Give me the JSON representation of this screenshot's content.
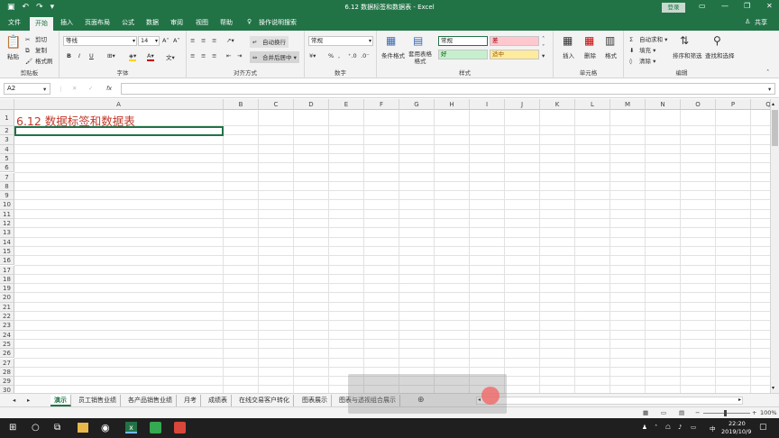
{
  "window": {
    "title": "6.12 数据标签和数据表 - Excel",
    "login": "登录",
    "share": "共享"
  },
  "tabs": [
    "文件",
    "开始",
    "插入",
    "页面布局",
    "公式",
    "数据",
    "审阅",
    "视图",
    "帮助"
  ],
  "tell_me": "操作说明搜索",
  "ribbon": {
    "clipboard": {
      "label": "剪贴板",
      "paste": "粘贴",
      "cut": "剪切",
      "copy": "复制",
      "format_painter": "格式刷"
    },
    "font": {
      "label": "字体",
      "name": "等线",
      "size": "14",
      "bold": "B",
      "italic": "I",
      "underline": "U"
    },
    "alignment": {
      "label": "对齐方式",
      "wrap": "自动换行",
      "merge": "合并后居中"
    },
    "number": {
      "label": "数字",
      "format": "常规",
      "percent": "%"
    },
    "styles": {
      "label": "样式",
      "cond_format": "条件格式",
      "table_format": "套用表格格式",
      "normal": "常规",
      "bad": "差",
      "good": "好",
      "neutral": "适中"
    },
    "cells": {
      "label": "单元格",
      "insert": "插入",
      "delete": "删除",
      "format": "格式"
    },
    "editing": {
      "label": "编辑",
      "autosum": "自动求和",
      "fill": "填充",
      "clear": "清除",
      "sort_filter": "排序和筛选",
      "find_select": "查找和选择"
    }
  },
  "formula_bar": {
    "name_box": "A2",
    "fx": "fx",
    "value": ""
  },
  "columns": [
    "A",
    "B",
    "C",
    "D",
    "E",
    "F",
    "G",
    "H",
    "I",
    "J",
    "K",
    "L",
    "M",
    "N",
    "O",
    "P",
    "Q"
  ],
  "rows": [
    "1",
    "2",
    "3",
    "4",
    "5",
    "6",
    "7",
    "8",
    "9",
    "10",
    "11",
    "12",
    "13",
    "14",
    "15",
    "16",
    "17",
    "18",
    "19",
    "20",
    "21",
    "22",
    "23",
    "24",
    "25",
    "26",
    "27",
    "28",
    "29",
    "30"
  ],
  "cells": {
    "A1": "6.12 数据标签和数据表"
  },
  "sheets": [
    "演示",
    "员工销售业绩",
    "各产品销售业绩",
    "月考",
    "成绩表",
    "在线交易客户转化",
    "图表展示",
    "图表与透视组合展示"
  ],
  "active_sheet": "演示",
  "status": {
    "zoom": "100%"
  },
  "taskbar": {
    "time": "22:20",
    "date": "2019/10/9",
    "ime": "中"
  },
  "colors": {
    "excel_green": "#217346",
    "title_red": "#c0392b",
    "good_bg": "#c6efce",
    "bad_bg": "#ffc7ce",
    "neutral_bg": "#ffeb9c"
  }
}
